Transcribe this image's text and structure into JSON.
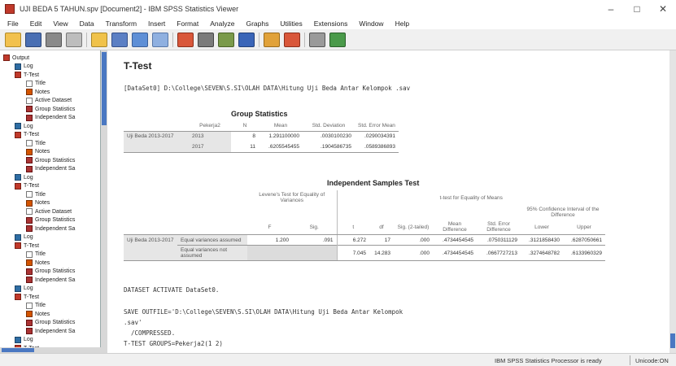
{
  "window": {
    "title": "UJI BEDA 5 TAHUN.spv [Document2] - IBM SPSS Statistics Viewer",
    "controls": [
      "–",
      "□",
      "✕"
    ]
  },
  "menu": [
    "File",
    "Edit",
    "View",
    "Data",
    "Transform",
    "Insert",
    "Format",
    "Analyze",
    "Graphs",
    "Utilities",
    "Extensions",
    "Window",
    "Help"
  ],
  "toolbar": {
    "icons": [
      "open-icon",
      "save-icon",
      "print-icon",
      "print-preview-icon",
      "export-icon",
      "dialog-recall-icon",
      "undo-icon",
      "redo-icon",
      "goto-data-icon",
      "goto-case-icon",
      "variables-icon",
      "designate-window-icon",
      "show-all-icon",
      "hide-icon",
      "insert-output-icon"
    ]
  },
  "outline": {
    "items": [
      {
        "label": "Output",
        "indent": 0,
        "icon": "book"
      },
      {
        "label": "Log",
        "indent": 1,
        "icon": "log"
      },
      {
        "label": "T-Test",
        "indent": 1,
        "icon": "book"
      },
      {
        "label": "Title",
        "indent": 2,
        "icon": "doc"
      },
      {
        "label": "Notes",
        "indent": 2,
        "icon": "notes"
      },
      {
        "label": "Active Dataset",
        "indent": 2,
        "icon": "doc"
      },
      {
        "label": "Group Statistics",
        "indent": 2,
        "icon": "table"
      },
      {
        "label": "Independent Sa",
        "indent": 2,
        "icon": "table"
      },
      {
        "label": "Log",
        "indent": 1,
        "icon": "log"
      },
      {
        "label": "T-Test",
        "indent": 1,
        "icon": "book"
      },
      {
        "label": "Title",
        "indent": 2,
        "icon": "doc"
      },
      {
        "label": "Notes",
        "indent": 2,
        "icon": "notes"
      },
      {
        "label": "Group Statistics",
        "indent": 2,
        "icon": "table"
      },
      {
        "label": "Independent Sa",
        "indent": 2,
        "icon": "table"
      },
      {
        "label": "Log",
        "indent": 1,
        "icon": "log"
      },
      {
        "label": "T-Test",
        "indent": 1,
        "icon": "book"
      },
      {
        "label": "Title",
        "indent": 2,
        "icon": "doc"
      },
      {
        "label": "Notes",
        "indent": 2,
        "icon": "notes"
      },
      {
        "label": "Active Dataset",
        "indent": 2,
        "icon": "doc"
      },
      {
        "label": "Group Statistics",
        "indent": 2,
        "icon": "table"
      },
      {
        "label": "Independent Sa",
        "indent": 2,
        "icon": "table"
      },
      {
        "label": "Log",
        "indent": 1,
        "icon": "log"
      },
      {
        "label": "T-Test",
        "indent": 1,
        "icon": "book"
      },
      {
        "label": "Title",
        "indent": 2,
        "icon": "doc"
      },
      {
        "label": "Notes",
        "indent": 2,
        "icon": "notes"
      },
      {
        "label": "Group Statistics",
        "indent": 2,
        "icon": "table"
      },
      {
        "label": "Independent Sa",
        "indent": 2,
        "icon": "table"
      },
      {
        "label": "Log",
        "indent": 1,
        "icon": "log"
      },
      {
        "label": "T-Test",
        "indent": 1,
        "icon": "book"
      },
      {
        "label": "Title",
        "indent": 2,
        "icon": "doc"
      },
      {
        "label": "Notes",
        "indent": 2,
        "icon": "notes"
      },
      {
        "label": "Group Statistics",
        "indent": 2,
        "icon": "table"
      },
      {
        "label": "Independent Sa",
        "indent": 2,
        "icon": "table"
      },
      {
        "label": "Log",
        "indent": 1,
        "icon": "log"
      },
      {
        "label": "T-Test",
        "indent": 1,
        "icon": "book"
      }
    ]
  },
  "content": {
    "heading": "T-Test",
    "dataset_line": "[DataSet0] D:\\College\\SEVEN\\S.SI\\OLAH DATA\\Hitung Uji Beda Antar Kelompok .sav",
    "group_stats": {
      "title": "Group Statistics",
      "headers": [
        "Pekerja2",
        "N",
        "Mean",
        "Std. Deviation",
        "Std. Error Mean"
      ],
      "row_label": "Uji Beda 2013-2017",
      "rows": [
        [
          "2013",
          "8",
          "1.291100000",
          ".0030100230",
          ".0290034391"
        ],
        [
          "2017",
          "11",
          ".6205545455",
          ".1904586735",
          ".0589386893"
        ]
      ]
    },
    "ind_test": {
      "title": "Independent Samples Test",
      "levene_header": "Levene's Test for Equality of Variances",
      "ttest_header": "t-test for Equality of Means",
      "ci_header": "95% Confidence Interval of the Difference",
      "col_headers": [
        "F",
        "Sig.",
        "t",
        "df",
        "Sig. (2-tailed)",
        "Mean Difference",
        "Std. Error Difference",
        "Lower",
        "Upper"
      ],
      "row_label": "Uji Beda 2013-2017",
      "rows": [
        {
          "label": "Equal variances assumed",
          "values": [
            "1.200",
            ".091",
            "6.272",
            "17",
            ".000",
            ".4734454545",
            ".0750311129",
            ".3121858430",
            ".6287050661"
          ]
        },
        {
          "label": "Equal variances not assumed",
          "values": [
            "",
            "",
            "7.045",
            "14.283",
            ".000",
            ".4734454545",
            ".0667727213",
            ".3274648782",
            ".6133960329"
          ]
        }
      ]
    },
    "syntax": [
      "DATASET ACTIVATE DataSet0.",
      "",
      "SAVE OUTFILE='D:\\College\\SEVEN\\S.SI\\OLAH DATA\\Hitung Uji Beda Antar Kelompok",
      ".sav'",
      "  /COMPRESSED.",
      "T-TEST GROUPS=Pekerja2(1 2)"
    ]
  },
  "status": {
    "processor": "IBM SPSS Statistics Processor is ready",
    "encoding": "Unicode:ON"
  }
}
